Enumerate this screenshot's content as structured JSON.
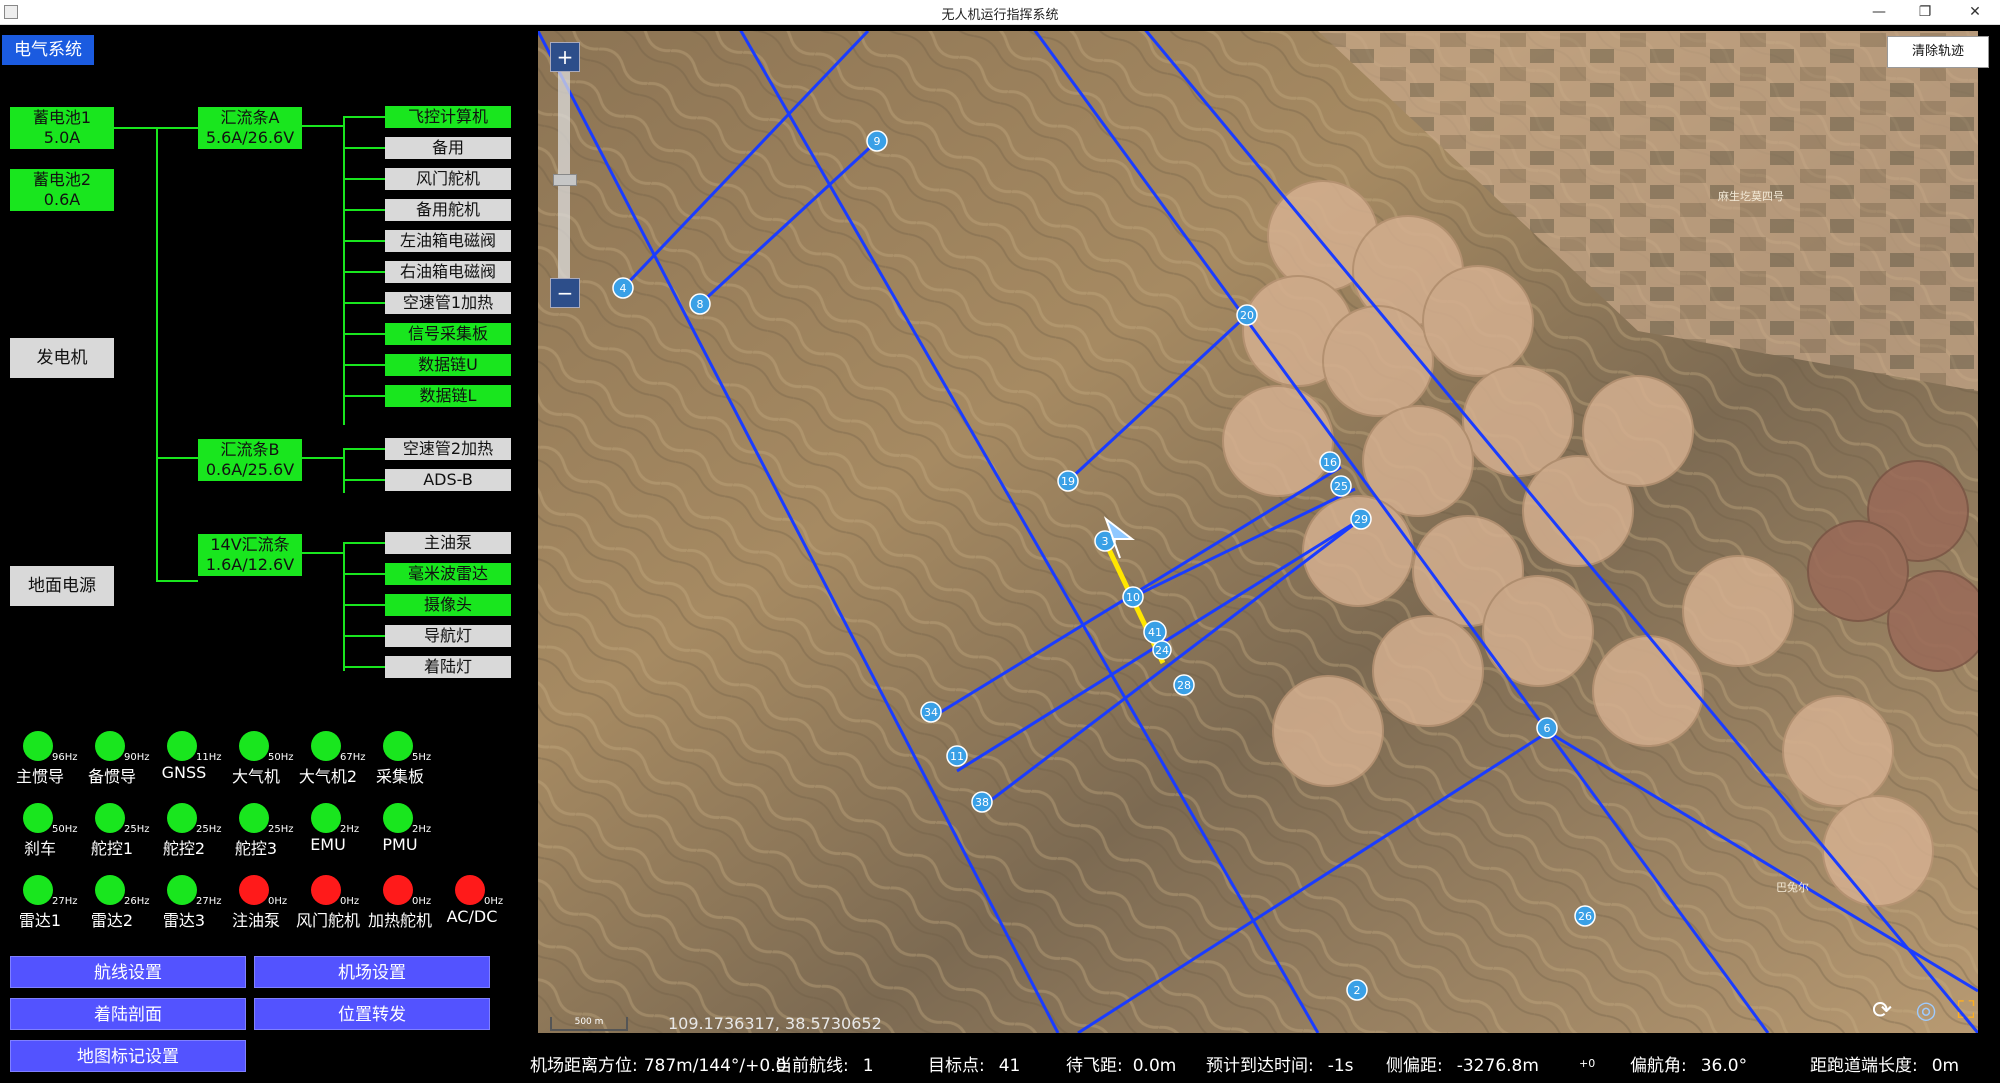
{
  "window": {
    "title": "无人机运行指挥系统"
  },
  "left": {
    "tab": "电气系统",
    "sources": [
      {
        "name": "蓄电池1",
        "value": "5.0A"
      },
      {
        "name": "蓄电池2",
        "value": "0.6A"
      }
    ],
    "generator": "发电机",
    "ground_power": "地面电源",
    "buses": [
      {
        "name": "汇流条A",
        "value": "5.6A/26.6V"
      },
      {
        "name": "汇流条B",
        "value": "0.6A/25.6V"
      },
      {
        "name": "14V汇流条",
        "value": "1.6A/12.6V"
      }
    ],
    "loads_a": [
      {
        "name": "飞控计算机",
        "on": true
      },
      {
        "name": "备用",
        "on": false
      },
      {
        "name": "风门舵机",
        "on": false
      },
      {
        "name": "备用舵机",
        "on": false
      },
      {
        "name": "左油箱电磁阀",
        "on": false
      },
      {
        "name": "右油箱电磁阀",
        "on": false
      },
      {
        "name": "空速管1加热",
        "on": false
      },
      {
        "name": "信号采集板",
        "on": true
      },
      {
        "name": "数据链U",
        "on": true
      },
      {
        "name": "数据链L",
        "on": true
      }
    ],
    "loads_b": [
      {
        "name": "空速管2加热",
        "on": false
      },
      {
        "name": "ADS-B",
        "on": false
      }
    ],
    "loads_14v": [
      {
        "name": "主油泵",
        "on": false
      },
      {
        "name": "毫米波雷达",
        "on": true
      },
      {
        "name": "摄像头",
        "on": true
      },
      {
        "name": "导航灯",
        "on": false
      },
      {
        "name": "着陆灯",
        "on": false
      }
    ],
    "indicators": [
      {
        "name": "主惯导",
        "hz": "96Hz",
        "on": true
      },
      {
        "name": "备惯导",
        "hz": "90Hz",
        "on": true
      },
      {
        "name": "GNSS",
        "hz": "11Hz",
        "on": true
      },
      {
        "name": "大气机",
        "hz": "50Hz",
        "on": true
      },
      {
        "name": "大气机2",
        "hz": "67Hz",
        "on": true
      },
      {
        "name": "采集板",
        "hz": "5Hz",
        "on": true
      },
      {
        "name": "刹车",
        "hz": "50Hz",
        "on": true
      },
      {
        "name": "舵控1",
        "hz": "25Hz",
        "on": true
      },
      {
        "name": "舵控2",
        "hz": "25Hz",
        "on": true
      },
      {
        "name": "舵控3",
        "hz": "25Hz",
        "on": true
      },
      {
        "name": "EMU",
        "hz": "2Hz",
        "on": true
      },
      {
        "name": "PMU",
        "hz": "2Hz",
        "on": true
      },
      {
        "name": "雷达1",
        "hz": "27Hz",
        "on": true
      },
      {
        "name": "雷达2",
        "hz": "26Hz",
        "on": true
      },
      {
        "name": "雷达3",
        "hz": "27Hz",
        "on": true
      },
      {
        "name": "注油泵",
        "hz": "0Hz",
        "on": false
      },
      {
        "name": "风门舵机",
        "hz": "0Hz",
        "on": false
      },
      {
        "name": "加热舵机",
        "hz": "0Hz",
        "on": false
      },
      {
        "name": "AC/DC",
        "hz": "0Hz",
        "on": false
      }
    ],
    "buttons": {
      "route": "航线设置",
      "airport": "机场设置",
      "profile": "着陆剖面",
      "relay": "位置转发",
      "marks": "地图标记设置"
    }
  },
  "map": {
    "clear_track": "清除轨迹",
    "coords": "109.1736317, 38.5730652",
    "scale": "500 m",
    "zoom_in": "+",
    "zoom_out": "−",
    "waypoints": [
      "9",
      "4",
      "8",
      "20",
      "19",
      "16",
      "25",
      "29",
      "3",
      "10",
      "41",
      "24",
      "28",
      "34",
      "11",
      "38",
      "6",
      "26",
      "2"
    ],
    "labels": [
      "麻生圪莫四号",
      "巴兔尔"
    ]
  },
  "status": {
    "airport_label": "机场距离方位:",
    "airport_value": "787m/144°/+0.0",
    "route_label": "当前航线:",
    "route_value": "1",
    "target_label": "目标点:",
    "target_value": "41",
    "togo_label": "待飞距:",
    "togo_value": "0.0m",
    "eta_label": "预计到达时间:",
    "eta_value": "-1s",
    "xtrack_label": "侧偏距:",
    "xtrack_value": "-3276.8m",
    "xtrack_sub": "+0",
    "heading_label": "偏航角:",
    "heading_value": "36.0°",
    "runway_label": "距跑道端长度:",
    "runway_value": "0m"
  }
}
